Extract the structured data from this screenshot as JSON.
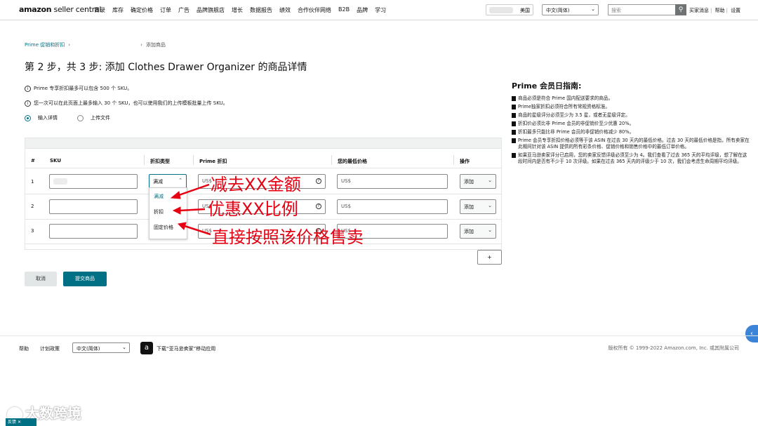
{
  "header": {
    "logo_bold": "amazon",
    "logo_light": " seller central",
    "nav": [
      "目录",
      "库存",
      "确定价格",
      "订单",
      "广告",
      "品牌旗舰店",
      "增长",
      "数据报告",
      "绩效",
      "合作伙伴网络",
      "B2B",
      "品牌",
      "学习"
    ],
    "store_label": "美国",
    "language": "中文(简体)",
    "search_placeholder": "搜索",
    "links": [
      "买家消息",
      "帮助",
      "设置"
    ]
  },
  "breadcrumb": {
    "first": "Prime 促销和折扣",
    "current": "添加商品"
  },
  "page_title": "第 2 步，共 3 步:  添加 Clothes Drawer Organizer 的商品详情",
  "info": [
    "Prime 专享折扣最多可以包含 500 个 SKU。",
    "您一次可以在此页面上最多输入 30 个 SKU，也可以使用我们的上传模板批量上传 SKU。"
  ],
  "input_mode": {
    "option_manual": "输入详情",
    "option_upload": "上传文件",
    "selected": "输入详情"
  },
  "table": {
    "headers": [
      "#",
      "SKU",
      "折扣类型",
      "Prime 折扣",
      "您的最低价格",
      "操作"
    ],
    "rows": [
      {
        "num": "1",
        "discount_type": "满减",
        "currency": "US$",
        "currency2": "US$",
        "action": "添加"
      },
      {
        "num": "2",
        "discount_type": "",
        "currency": "US$",
        "currency2": "US$",
        "action": "添加"
      },
      {
        "num": "3",
        "discount_type": "",
        "currency": "US$",
        "currency2": "US$",
        "action": "添加"
      }
    ],
    "dropdown_options": [
      "满减",
      "折扣",
      "固定价格"
    ],
    "add_row": "+"
  },
  "buttons": {
    "cancel": "取消",
    "submit": "提交商品"
  },
  "annotations": [
    "减去XX金额",
    "优惠XX比例",
    "直接按照该价格售卖"
  ],
  "guide": {
    "title": "Prime 会员日指南:",
    "items": [
      "商品必须是符合 Prime 国内配送要求的商品。",
      "Prime独家折扣必须符合所有常规资格标准。",
      "商品的星级评分必须至少为 3.5 星，或者无星级评定。",
      "折扣价必须比非 Prime 会员的非促销价至少优惠 20%。",
      "折扣最多只能比非 Prime 会员的非促销价格减少 80%。",
      "Prime 会员专享折扣价格必须等于该 ASIN 在过去 30 天内的最低价格。过去 30 天的最低价格是指，所有卖家在此期间针对该 ASIN 提供的所有彩条价格、促销价格和销售价格中的最低订单价格。",
      "如果亚马逊卖家评分已启用，您的卖家反馈评级必须至少为 4。我们查看了过去 365 天的平均评级，想了解在这段时间内是否有不少于 10 次评级。如果在过去 365 天内的评级少于 10 次，我们会考虑生命周期平均评级。"
    ]
  },
  "footer": {
    "help": "帮助",
    "policy": "计划政策",
    "language": "中文(简体)",
    "app_text": "下载“亚马逊卖家”移动应用",
    "copyright": "版权所有 © 1999-2022 Amazon.com, Inc. 或其附属公司"
  },
  "watermark": "大数跨境",
  "feedback": "反馈",
  "colors": {
    "accent": "#007185",
    "annotation": "#e60012"
  }
}
